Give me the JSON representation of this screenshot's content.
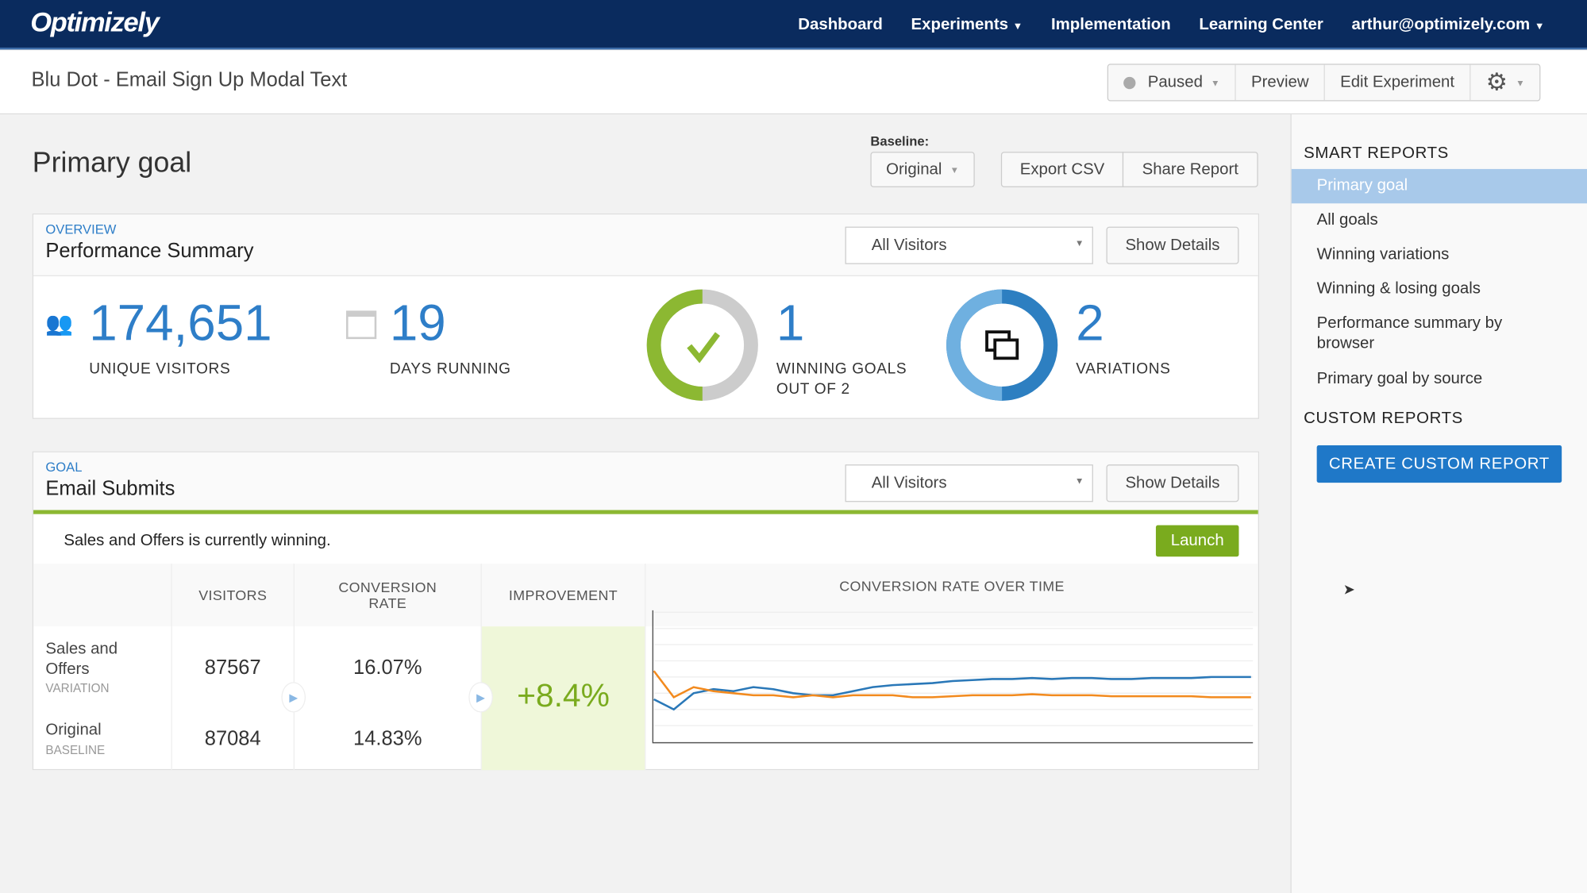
{
  "nav": {
    "logo": "Optimizely",
    "items": [
      "Dashboard",
      "Experiments",
      "Implementation",
      "Learning Center"
    ],
    "user": "arthur@optimizely.com"
  },
  "header": {
    "title": "Blu Dot - Email Sign Up Modal Text",
    "status": "Paused",
    "preview": "Preview",
    "edit": "Edit Experiment",
    "settings_icon": "gear-icon"
  },
  "page": {
    "title": "Primary goal",
    "baseline_label": "Baseline:",
    "baseline_value": "Original",
    "export": "Export CSV",
    "share": "Share Report"
  },
  "overview": {
    "eyebrow": "OVERVIEW",
    "title": "Performance Summary",
    "segment": "All Visitors",
    "details": "Show Details",
    "visitors": "174,651",
    "visitors_label": "UNIQUE VISITORS",
    "days": "19",
    "days_label": "DAYS RUNNING",
    "winning": "1",
    "winning_label1": "WINNING GOALS",
    "winning_label2": "OUT OF 2",
    "winning_fraction": 0.5,
    "variations": "2",
    "variations_label": "VARIATIONS",
    "colors": {
      "accent": "#2e7ec8",
      "green": "#8cb832"
    }
  },
  "goal": {
    "eyebrow": "GOAL",
    "title": "Email Submits",
    "segment": "All Visitors",
    "details": "Show Details",
    "winning_text": "Sales and Offers is currently winning.",
    "launch": "Launch",
    "columns": {
      "visitors": "VISITORS",
      "conv1": "CONVERSION",
      "conv2": "RATE",
      "improvement": "IMPROVEMENT",
      "chart": "CONVERSION RATE OVER TIME"
    },
    "rows": [
      {
        "name1": "Sales and",
        "name2": "Offers",
        "type": "VARIATION",
        "visitors": "87567",
        "rate": "16.07%"
      },
      {
        "name1": "Original",
        "name2": "",
        "type": "BASELINE",
        "visitors": "87084",
        "rate": "14.83%"
      }
    ],
    "improvement": "+8.4%",
    "chart": {
      "series": [
        {
          "color": "#2a78b8",
          "values": [
            12,
            2,
            18,
            22,
            20,
            24,
            22,
            18,
            16,
            16,
            20,
            24,
            26,
            27,
            28,
            30,
            31,
            32,
            32,
            33,
            32,
            33,
            33,
            32,
            32,
            33,
            33,
            33,
            34,
            34,
            34
          ]
        },
        {
          "color": "#f28a1e",
          "values": [
            40,
            14,
            24,
            20,
            18,
            16,
            16,
            14,
            16,
            14,
            16,
            16,
            16,
            14,
            14,
            15,
            16,
            16,
            16,
            17,
            16,
            16,
            16,
            15,
            15,
            15,
            15,
            15,
            14,
            14,
            14
          ]
        }
      ]
    }
  },
  "sidebar": {
    "smart": "SMART REPORTS",
    "items": [
      "Primary goal",
      "All goals",
      "Winning variations",
      "Winning & losing goals",
      "Performance summary by browser",
      "Primary goal by source"
    ],
    "custom": "CUSTOM REPORTS",
    "create": "CREATE CUSTOM REPORT"
  }
}
